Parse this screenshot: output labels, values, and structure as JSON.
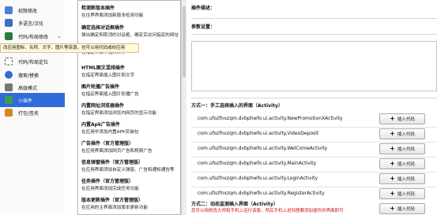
{
  "sidebar": {
    "items": [
      {
        "label": "权限修改",
        "icon": "shield-icon",
        "color": "#4a7fd0"
      },
      {
        "label": "多语言/汉化",
        "icon": "language-icon",
        "color": "#3b6fc0"
      },
      {
        "label": "代码/布局修改",
        "icon": "code-icon",
        "color": "#2f7a3a"
      },
      {
        "label": "代码/布局定位",
        "icon": "locate-icon",
        "color": "#555555"
      },
      {
        "label": "搜索/替换",
        "icon": "search-icon",
        "color": "#2f6bd9"
      },
      {
        "label": "高级模式",
        "icon": "wrench-icon",
        "color": "#666666"
      },
      {
        "label": "小插件",
        "icon": "plugin-icon",
        "color": "#3aa050"
      },
      {
        "label": "打包/签名",
        "icon": "package-icon",
        "color": "#d08a20"
      }
    ],
    "selected_index": 6,
    "tooltip": "改应用图标、名称、文字、图片等资源，也可以用代码或纷应用"
  },
  "menu": {
    "items": [
      {
        "title": "检测新版本插件",
        "desc": "在往界界面添加新版本检测功能"
      },
      {
        "title": "确定选择对话框插件",
        "desc": "弹出确定和取消的对话框，确定后访问指定的网址"
      },
      {
        "title": "",
        "desc": "在指定界面中插入文字"
      },
      {
        "title": "HTML图文混排插件",
        "desc": "在指定界面插入图片和文字"
      },
      {
        "title": "图片轮播广告插件",
        "desc": "在指定界面插入图片轮播广告"
      },
      {
        "title": "内置网址浏览器插件",
        "desc": "在指定界面添加浏览内网页的显示功能"
      },
      {
        "title": "内置Apk广告插件",
        "desc": "在应用中添加内置APK安装包"
      },
      {
        "title": "广告插件（官方管理版）",
        "desc": "在应用界面添加网页广告和视频广告"
      },
      {
        "title": "信息弹窗插件（官方管理版）",
        "desc": "在应用界面添加自定义弹窗、广告和通知通告等"
      },
      {
        "title": "任务插件（官方管理版）",
        "desc": "在应用界面添加完成任务功能"
      },
      {
        "title": "版本更新插件（官方管理版）",
        "desc": "在应用的主界面添加版本更新功能"
      }
    ]
  },
  "main": {
    "plugin_desc_label": "插件描述：",
    "params_label": "参数设置：",
    "method1_label": "方式一：手工选择插入的界面（Activity）",
    "method2_label": "方式二：动态监测插入界面（Activity）",
    "insert_button_label": "插入代码",
    "activities": [
      "com.ufozfnxzqm.dvbphwfo.ui.activity.NewPromotionXActivity",
      "com.ufozfnxzqm.dvbphwfo.ui.activity.VideoDeposit",
      "com.ufozfnxzqm.dvbphwfo.ui.activity.WelComeActivity",
      "com.ufozfnxzqm.dvbphwfo.ui.activity.MainActivity",
      "com.ufozfnxzqm.dvbphwfo.ui.activity.LoginActivity",
      "com.ufozfnxzqm.dvbphwfo.ui.activity.RegisterActivity"
    ],
    "warning": "您可以用修改大师和手机上运行该版，然后手机上进到想要添加插件的界面即可"
  }
}
